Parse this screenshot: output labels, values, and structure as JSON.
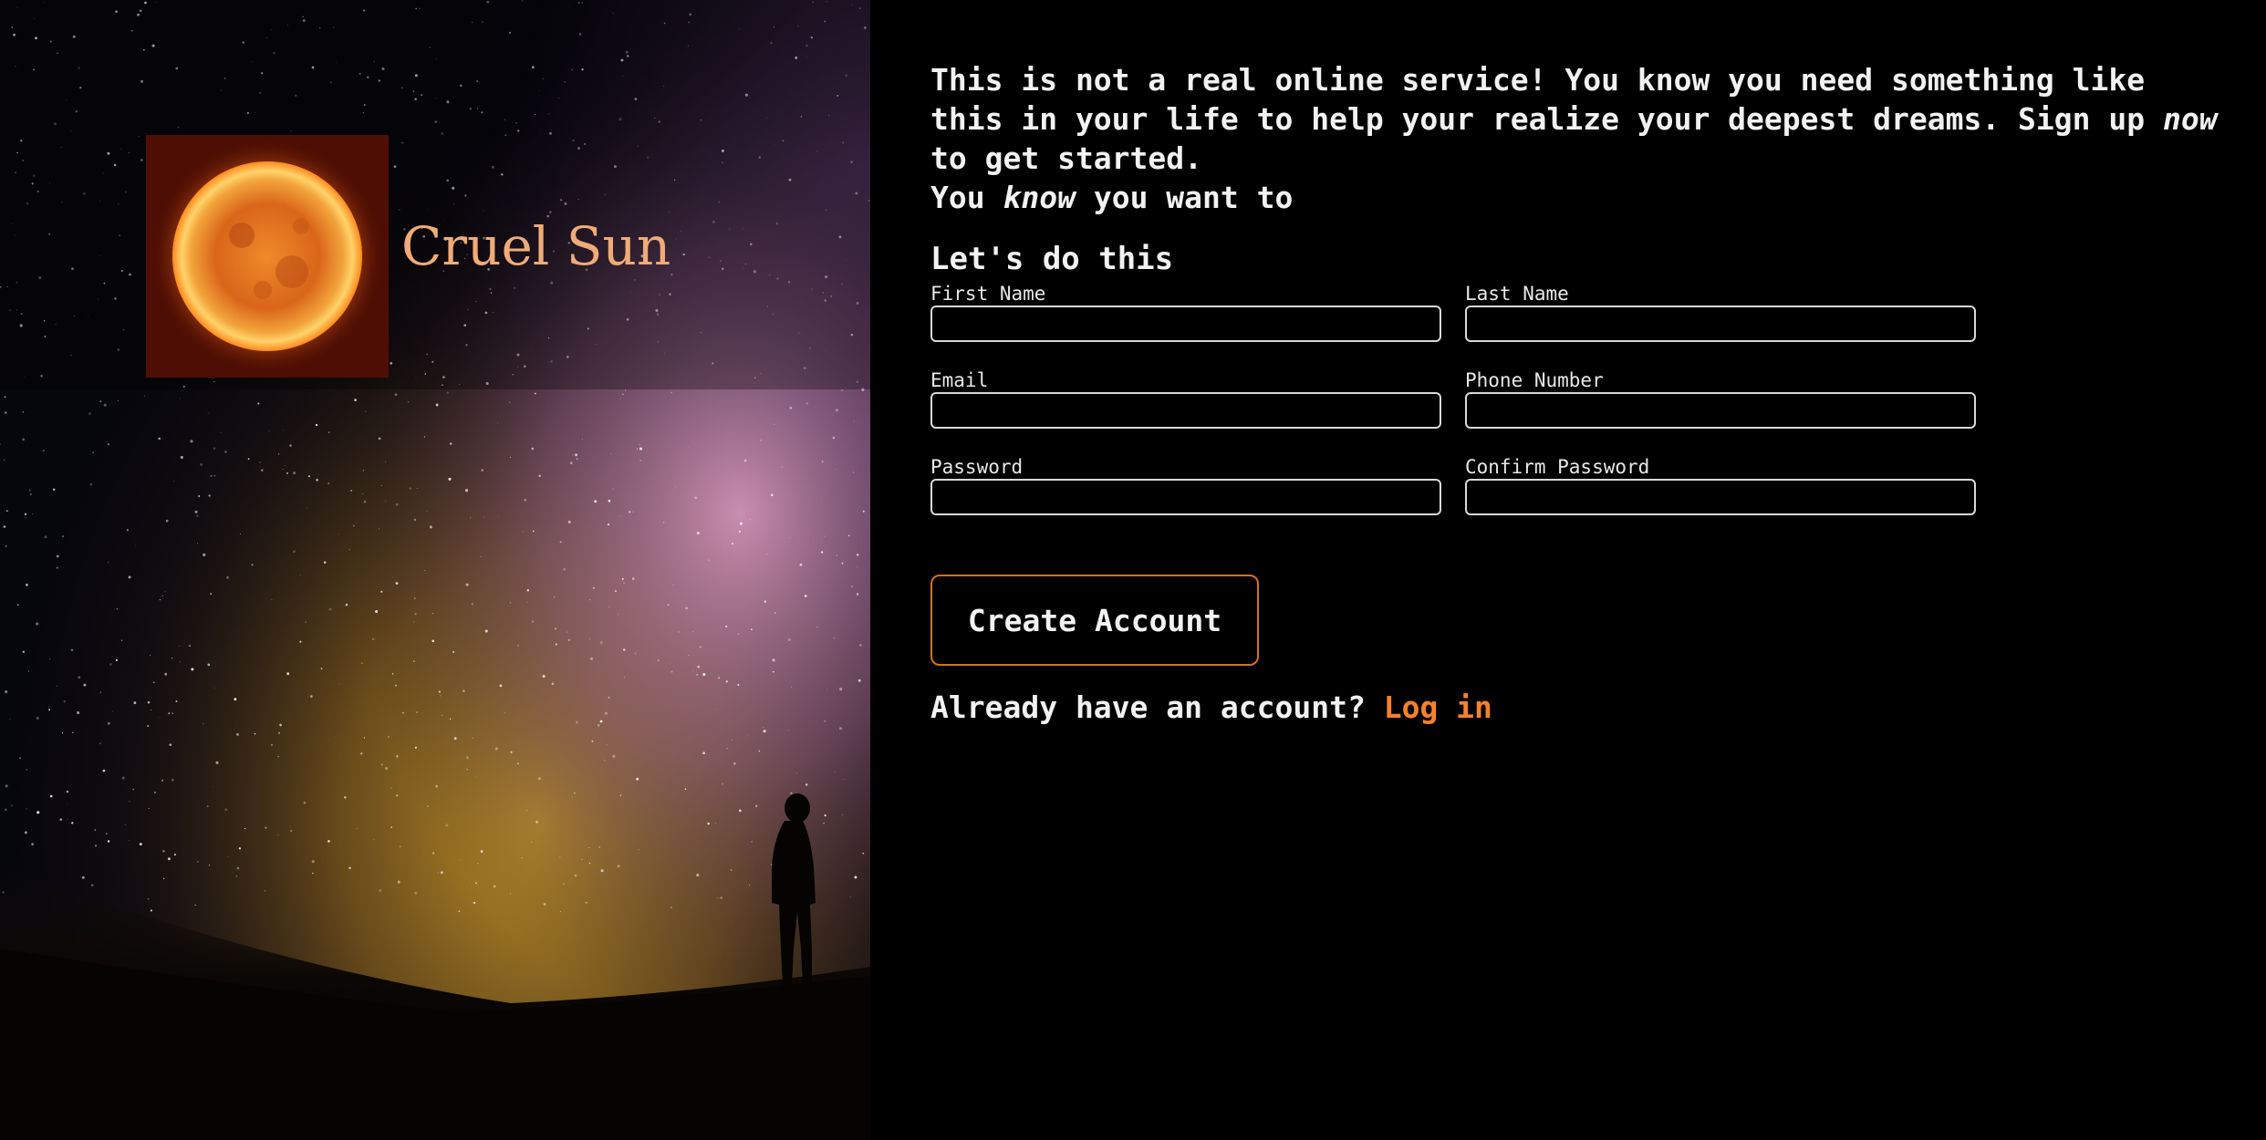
{
  "brand": {
    "name": "Cruel Sun",
    "accent_color": "#f0ab78"
  },
  "intro": {
    "part1": "This is not a real online service! You know you need something like this in your life to help your realize your deepest dreams. Sign up ",
    "emphasis1": "now",
    "part2": " to get started.",
    "line2_start": "You ",
    "emphasis2": "know",
    "line2_end": " you want to"
  },
  "form": {
    "heading": "Let's do this",
    "fields": [
      {
        "label": "First Name",
        "value": ""
      },
      {
        "label": "Last Name",
        "value": ""
      },
      {
        "label": "Email",
        "value": ""
      },
      {
        "label": "Phone Number",
        "value": ""
      },
      {
        "label": "Password",
        "value": ""
      },
      {
        "label": "Confirm Password",
        "value": ""
      }
    ],
    "submit_label": "Create Account",
    "submit_border_color": "#d07322"
  },
  "login": {
    "prompt": "Already have an account? ",
    "link_label": "Log in",
    "link_color": "#f5822a"
  }
}
